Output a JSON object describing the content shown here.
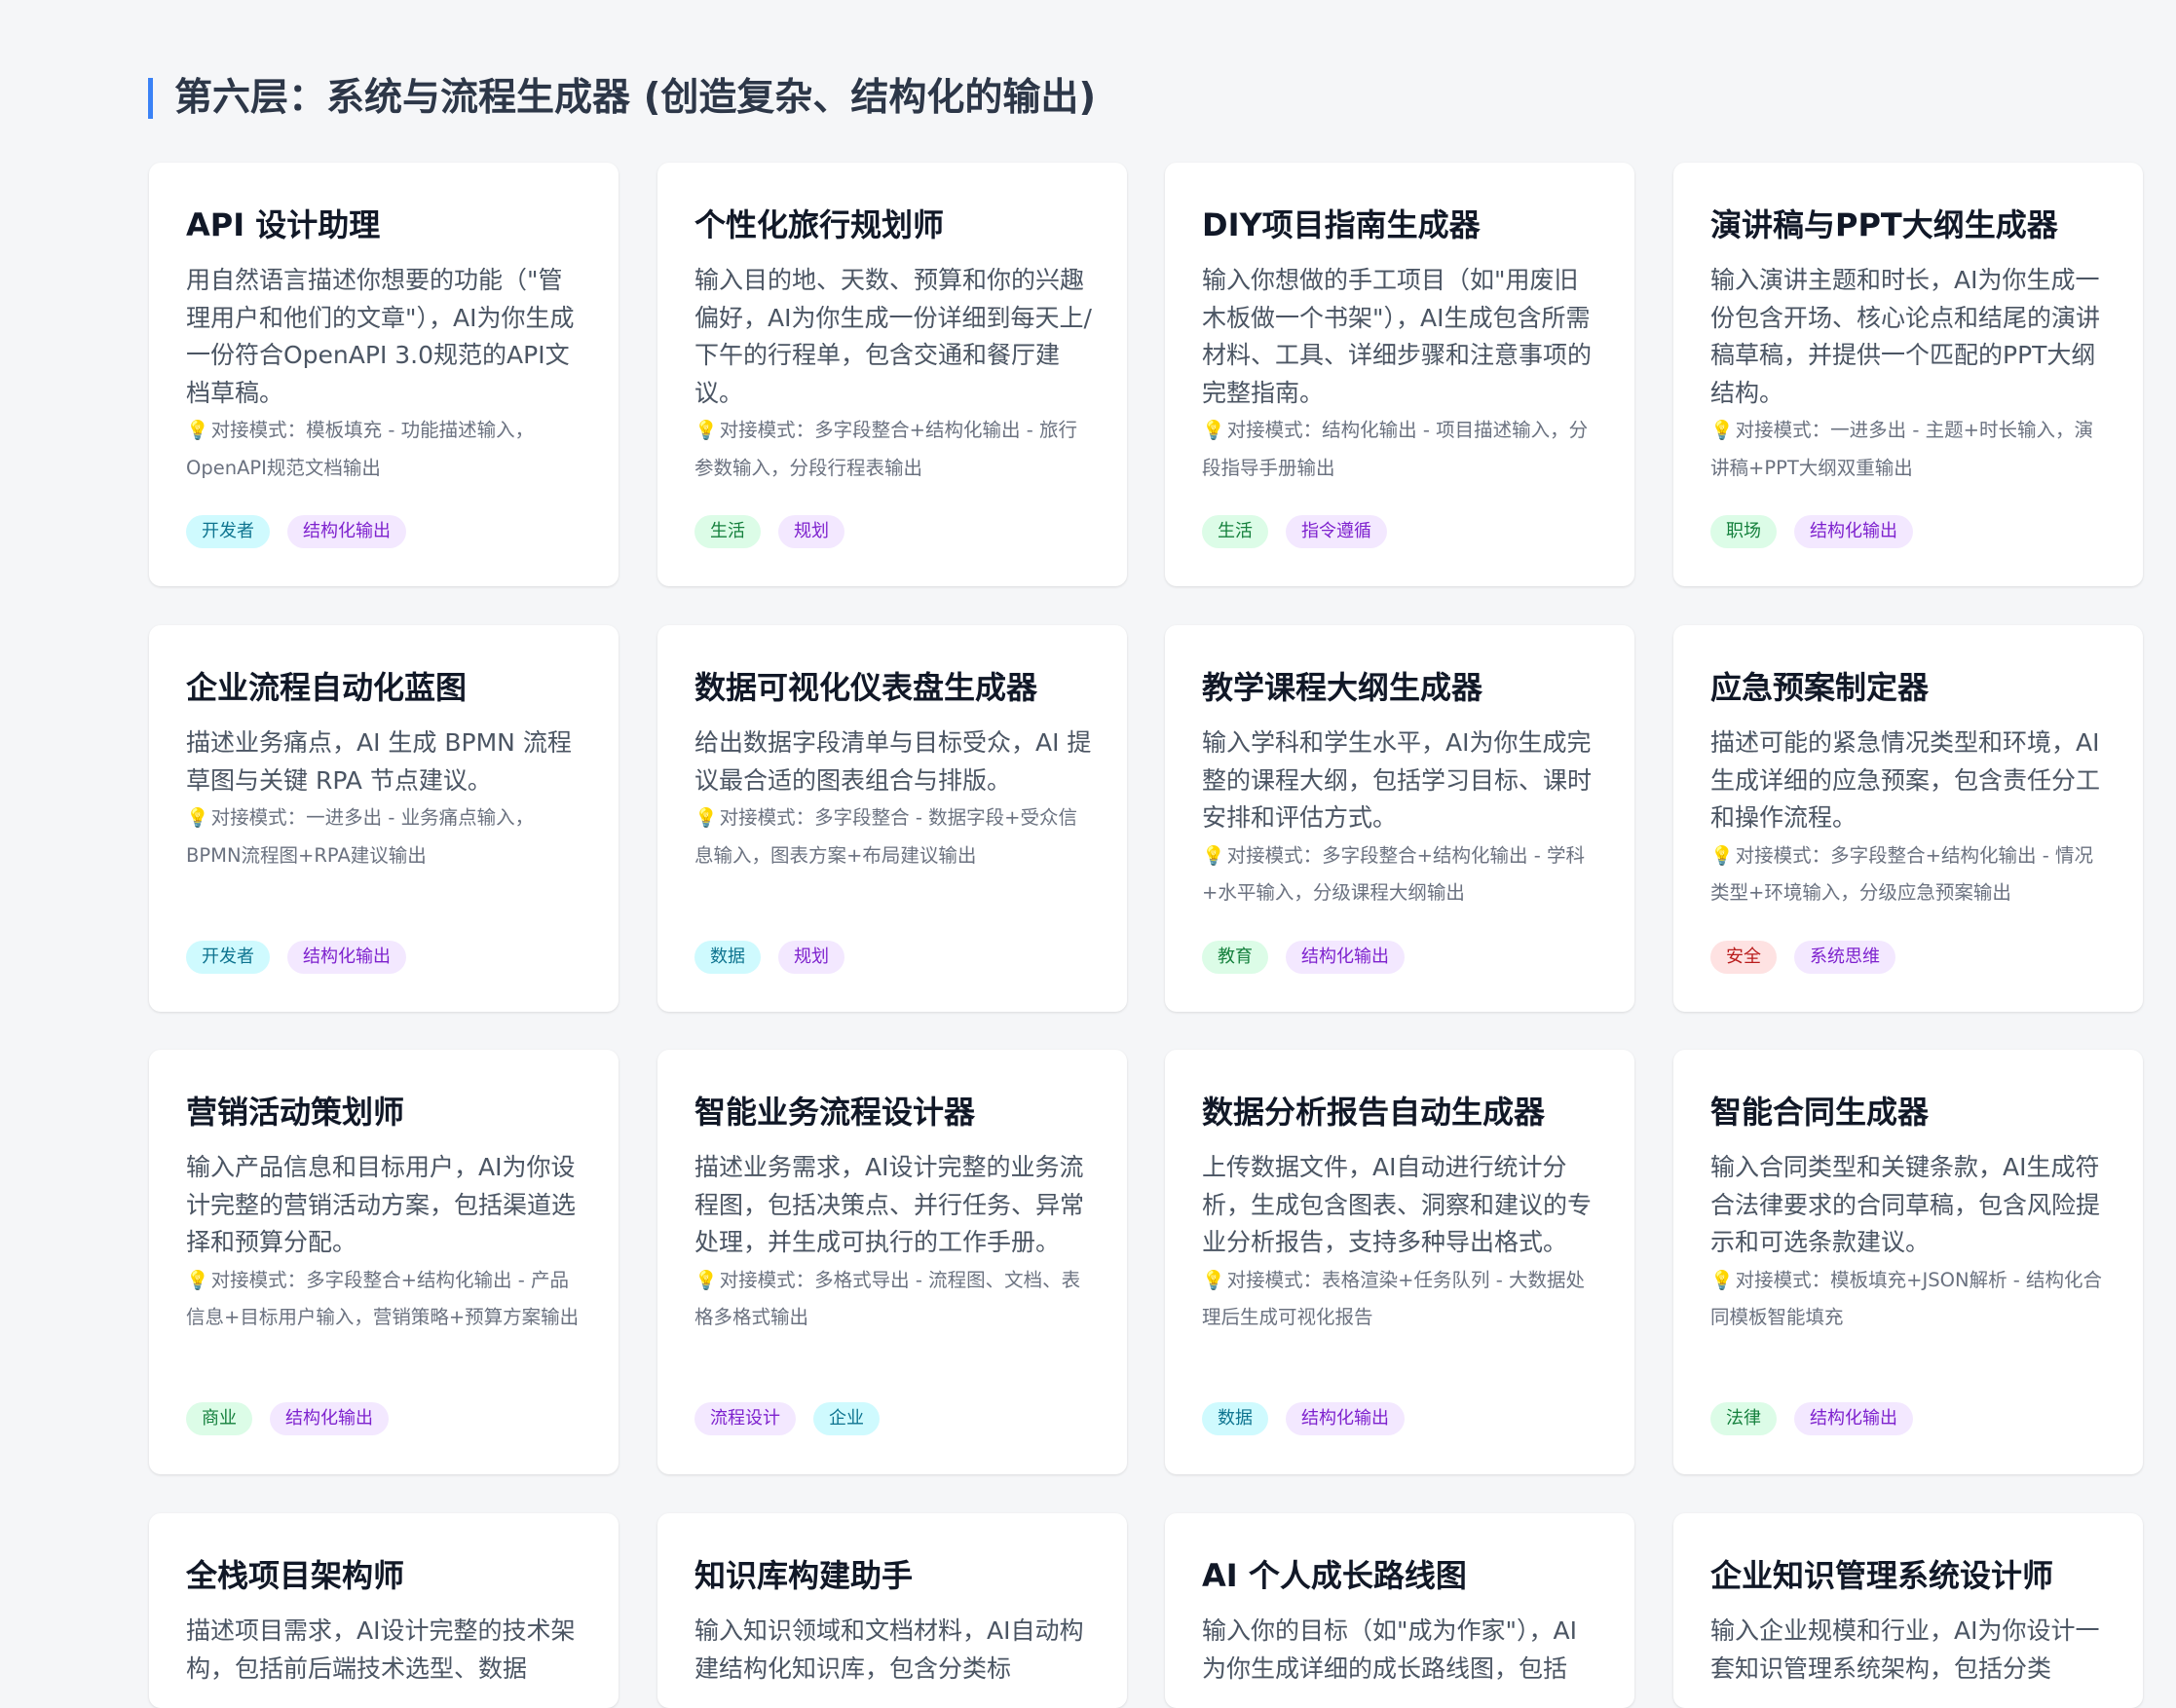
{
  "section": {
    "title": "第六层：系统与流程生成器 (创造复杂、结构化的输出)",
    "accent": "#3b82f6"
  },
  "tag_colors": {
    "cyan": "#cffafe",
    "purple": "#f3e8ff",
    "green": "#dcfce7",
    "red": "#fee2e2"
  },
  "cards": [
    {
      "title": "API 设计助理",
      "desc": "用自然语言描述你想要的功能（\"管理用户和他们的文章\"），AI为你生成一份符合OpenAPI 3.0规范的API文档草稿。",
      "mode": "对接模式：模板填充 - 功能描述输入，OpenAPI规范文档输出",
      "tags": [
        {
          "label": "开发者",
          "color": "cyan"
        },
        {
          "label": "结构化输出",
          "color": "purple"
        }
      ]
    },
    {
      "title": "个性化旅行规划师",
      "desc": "输入目的地、天数、预算和你的兴趣偏好，AI为你生成一份详细到每天上/下午的行程单，包含交通和餐厅建议。",
      "mode": "对接模式：多字段整合+结构化输出 - 旅行参数输入，分段行程表输出",
      "tags": [
        {
          "label": "生活",
          "color": "green"
        },
        {
          "label": "规划",
          "color": "purple"
        }
      ]
    },
    {
      "title": "DIY项目指南生成器",
      "desc": "输入你想做的手工项目（如\"用废旧木板做一个书架\"），AI生成包含所需材料、工具、详细步骤和注意事项的完整指南。",
      "mode": "对接模式：结构化输出 - 项目描述输入，分段指导手册输出",
      "tags": [
        {
          "label": "生活",
          "color": "green"
        },
        {
          "label": "指令遵循",
          "color": "purple"
        }
      ]
    },
    {
      "title": "演讲稿与PPT大纲生成器",
      "desc": "输入演讲主题和时长，AI为你生成一份包含开场、核心论点和结尾的演讲稿草稿，并提供一个匹配的PPT大纲结构。",
      "mode": "对接模式：一进多出 - 主题+时长输入，演讲稿+PPT大纲双重输出",
      "tags": [
        {
          "label": "职场",
          "color": "green"
        },
        {
          "label": "结构化输出",
          "color": "purple"
        }
      ]
    },
    {
      "title": "企业流程自动化蓝图",
      "desc": "描述业务痛点，AI 生成 BPMN 流程草图与关键 RPA 节点建议。",
      "mode": "对接模式：一进多出 - 业务痛点输入，BPMN流程图+RPA建议输出",
      "tags": [
        {
          "label": "开发者",
          "color": "cyan"
        },
        {
          "label": "结构化输出",
          "color": "purple"
        }
      ]
    },
    {
      "title": "数据可视化仪表盘生成器",
      "desc": "给出数据字段清单与目标受众，AI 提议最合适的图表组合与排版。",
      "mode": "对接模式：多字段整合 - 数据字段+受众信息输入，图表方案+布局建议输出",
      "tags": [
        {
          "label": "数据",
          "color": "cyan"
        },
        {
          "label": "规划",
          "color": "purple"
        }
      ]
    },
    {
      "title": "教学课程大纲生成器",
      "desc": "输入学科和学生水平，AI为你生成完整的课程大纲，包括学习目标、课时安排和评估方式。",
      "mode": "对接模式：多字段整合+结构化输出 - 学科+水平输入，分级课程大纲输出",
      "tags": [
        {
          "label": "教育",
          "color": "green"
        },
        {
          "label": "结构化输出",
          "color": "purple"
        }
      ]
    },
    {
      "title": "应急预案制定器",
      "desc": "描述可能的紧急情况类型和环境，AI生成详细的应急预案，包含责任分工和操作流程。",
      "mode": "对接模式：多字段整合+结构化输出 - 情况类型+环境输入，分级应急预案输出",
      "tags": [
        {
          "label": "安全",
          "color": "red"
        },
        {
          "label": "系统思维",
          "color": "purple"
        }
      ]
    },
    {
      "title": "营销活动策划师",
      "desc": "输入产品信息和目标用户，AI为你设计完整的营销活动方案，包括渠道选择和预算分配。",
      "mode": "对接模式：多字段整合+结构化输出 - 产品信息+目标用户输入，营销策略+预算方案输出",
      "tags": [
        {
          "label": "商业",
          "color": "green"
        },
        {
          "label": "结构化输出",
          "color": "purple"
        }
      ]
    },
    {
      "title": "智能业务流程设计器",
      "desc": "描述业务需求，AI设计完整的业务流程图，包括决策点、并行任务、异常处理，并生成可执行的工作手册。",
      "mode": "对接模式：多格式导出 - 流程图、文档、表格多格式输出",
      "tags": [
        {
          "label": "流程设计",
          "color": "purple"
        },
        {
          "label": "企业",
          "color": "cyan"
        }
      ]
    },
    {
      "title": "数据分析报告自动生成器",
      "desc": "上传数据文件，AI自动进行统计分析，生成包含图表、洞察和建议的专业分析报告，支持多种导出格式。",
      "mode": "对接模式：表格渲染+任务队列 - 大数据处理后生成可视化报告",
      "tags": [
        {
          "label": "数据",
          "color": "cyan"
        },
        {
          "label": "结构化输出",
          "color": "purple"
        }
      ]
    },
    {
      "title": "智能合同生成器",
      "desc": "输入合同类型和关键条款，AI生成符合法律要求的合同草稿，包含风险提示和可选条款建议。",
      "mode": "对接模式：模板填充+JSON解析 - 结构化合同模板智能填充",
      "tags": [
        {
          "label": "法律",
          "color": "green"
        },
        {
          "label": "结构化输出",
          "color": "purple"
        }
      ]
    },
    {
      "title": "全栈项目架构师",
      "desc": "描述项目需求，AI设计完整的技术架构，包括前后端技术选型、数据",
      "mode": "",
      "tags": []
    },
    {
      "title": "知识库构建助手",
      "desc": "输入知识领域和文档材料，AI自动构建结构化知识库，包含分类标",
      "mode": "",
      "tags": []
    },
    {
      "title": "AI 个人成长路线图",
      "desc": "输入你的目标（如\"成为作家\"），AI为你生成详细的成长路线图，包括",
      "mode": "",
      "tags": []
    },
    {
      "title": "企业知识管理系统设计师",
      "desc": "输入企业规模和行业，AI为你设计一套知识管理系统架构，包括分类",
      "mode": "",
      "tags": []
    }
  ]
}
